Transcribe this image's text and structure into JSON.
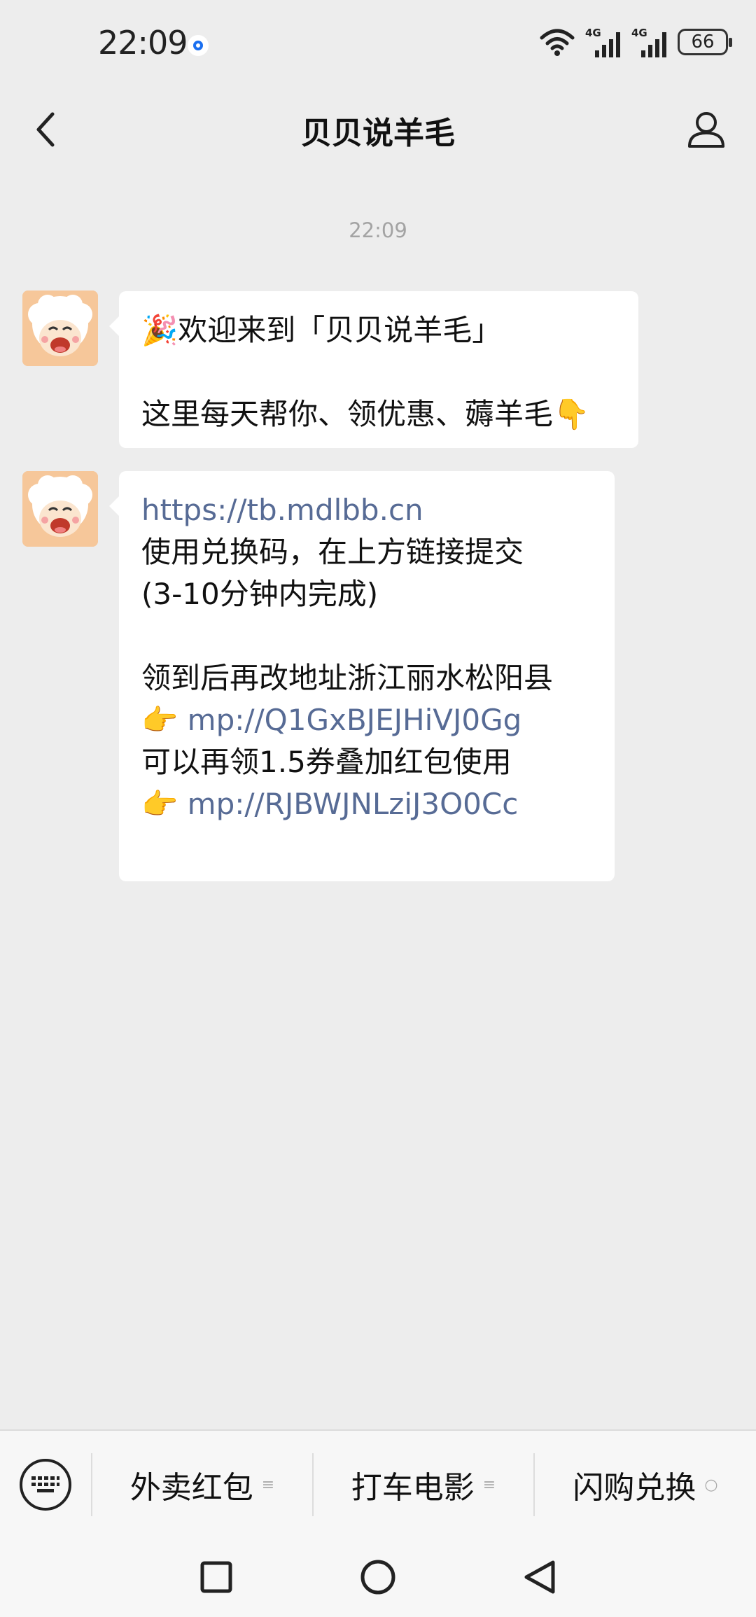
{
  "status_bar": {
    "time": "22:09",
    "net_type_1": "4G",
    "net_type_2": "4G",
    "battery": "66"
  },
  "header": {
    "title": "贝贝说羊毛"
  },
  "chat": {
    "timestamp": "22:09",
    "messages": [
      {
        "lines": [
          "🎉欢迎来到「贝贝说羊毛」",
          "",
          "这里每天帮你、领优惠、薅羊毛👇"
        ]
      },
      {
        "link": "https://tb.mdlbb.cn",
        "line2": "使用兑换码，在上方链接提交",
        "line3": "(3-10分钟内完成)",
        "line5": "领到后再改地址浙江丽水松阳县",
        "pointer": "👉",
        "mp_link_1": "mp://Q1GxBJEJHiVJ0Gg",
        "line7": "可以再领1.5券叠加红包使用",
        "mp_link_2": "mp://RJBWJNLziJ3O0Cc"
      }
    ]
  },
  "menu": {
    "items": [
      {
        "label": "外卖红包",
        "mark": "≡"
      },
      {
        "label": "打车电影",
        "mark": "≡"
      },
      {
        "label": "闪购兑换",
        "mark": "○"
      }
    ]
  },
  "icons": {
    "back": "chevron-left-icon",
    "profile": "person-icon",
    "keyboard": "keyboard-icon",
    "nav_recent": "square-icon",
    "nav_home": "circle-icon",
    "nav_back": "triangle-left-icon"
  },
  "colors": {
    "background": "#ededed",
    "bubble": "#ffffff",
    "link": "#576b95",
    "timestamp": "#a3a3a3"
  }
}
